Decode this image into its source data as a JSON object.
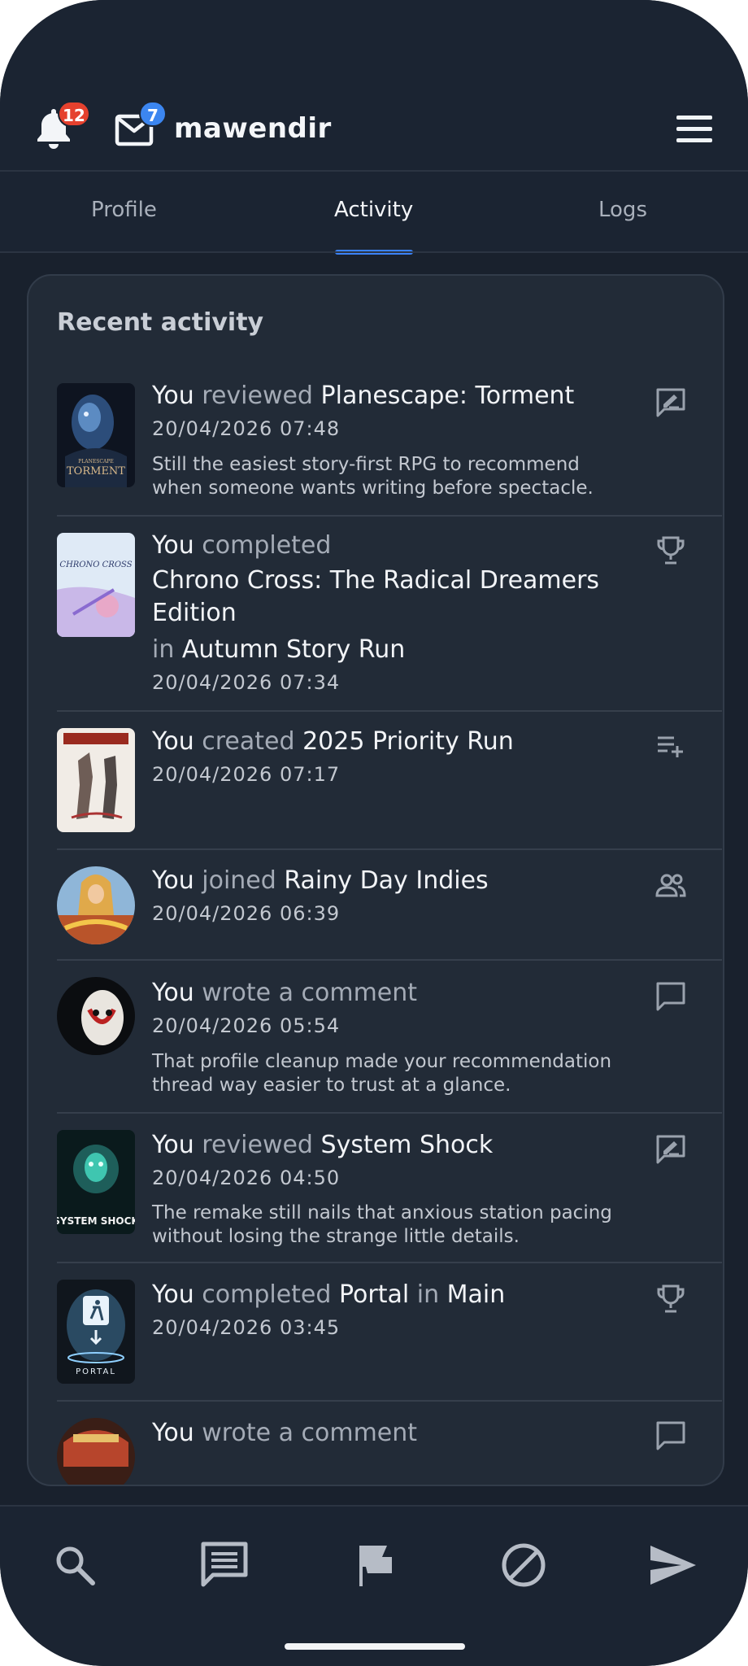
{
  "header": {
    "notifications_count": "12",
    "messages_count": "7",
    "username": "mawendir"
  },
  "tabs": [
    {
      "label": "Profile",
      "active": false
    },
    {
      "label": "Activity",
      "active": true
    },
    {
      "label": "Logs",
      "active": false
    }
  ],
  "activity": {
    "title": "Recent activity",
    "items": [
      {
        "subject": "You",
        "verb": "reviewed",
        "target": "Planescape: Torment",
        "timestamp": "20/04/2026 07:48",
        "snippet_line1": "Still the easiest story-first RPG to recommend",
        "snippet_line2": "when someone wants writing before spectacle.",
        "icon": "review-icon"
      },
      {
        "subject": "You",
        "verb": "completed",
        "target_line1": "Chrono Cross: The Radical Dreamers",
        "target_line2": "Edition",
        "context_prep": "in",
        "context": "Autumn Story Run",
        "timestamp": "20/04/2026 07:34",
        "icon": "trophy-icon"
      },
      {
        "subject": "You",
        "verb": "created",
        "target": "2025 Priority Run",
        "timestamp": "20/04/2026 07:17",
        "icon": "playlist-add-icon"
      },
      {
        "subject": "You",
        "verb": "joined",
        "target": "Rainy Day Indies",
        "timestamp": "20/04/2026 06:39",
        "icon": "group-icon"
      },
      {
        "subject": "You",
        "verb": "wrote a comment",
        "timestamp": "20/04/2026 05:54",
        "snippet_line1": "That profile cleanup made your recommendation",
        "snippet_line2": "thread way easier to trust at a glance.",
        "icon": "comment-icon"
      },
      {
        "subject": "You",
        "verb": "reviewed",
        "target": "System Shock",
        "timestamp": "20/04/2026 04:50",
        "snippet_line1": "The remake still nails that anxious station pacing",
        "snippet_line2": "without losing the strange little details.",
        "icon": "review-icon"
      },
      {
        "subject": "You",
        "verb": "completed",
        "target": "Portal",
        "context_prep": "in",
        "context": "Main",
        "timestamp": "20/04/2026 03:45",
        "icon": "trophy-icon"
      },
      {
        "subject": "You",
        "verb": "wrote a comment",
        "icon": "comment-icon"
      }
    ]
  },
  "thumbnails": {
    "torment": {
      "text_top": "PLANESCAPE",
      "text": "TORMENT"
    },
    "chrono": {
      "text": "CHRONO CROSS"
    },
    "system_shock": {
      "text": "SYSTEM SHOCK"
    },
    "portal": {
      "text": "PORTAL"
    }
  },
  "bottom_nav": [
    "search-icon",
    "chat-icon",
    "flag-icon",
    "block-icon",
    "send-icon"
  ],
  "colors": {
    "accent": "#3b82f6",
    "badge_red": "#e5412e",
    "badge_blue": "#3c86f0",
    "background": "#19212d",
    "card": "#222b37"
  }
}
